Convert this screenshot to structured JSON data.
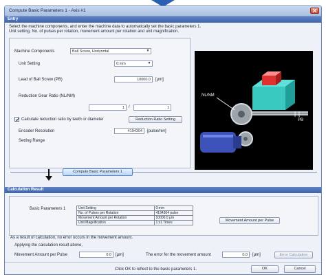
{
  "window": {
    "title": "Compute Basic Parameters 1 - Axis #1"
  },
  "entry": {
    "header": "Entry",
    "description_1": "Select the machine components, and enter the machine data to automatically set the basic parameters 1.",
    "description_2": "Unit setting, No. of pulses per rotation, movement amount per rotation and unit magnification.",
    "machine_components_label": "Machine Components",
    "machine_components_value": "Ball Screw, Horizontal",
    "unit_setting_label": "Unit Setting",
    "unit_setting_value": "0:mm",
    "lead_label": "Lead of Ball Screw (PB)",
    "lead_value": "10000.0",
    "lead_unit": "[μm]",
    "reduction_label": "Reduction Gear Ratio (NL/NM)",
    "reduction_num": "1",
    "reduction_den": "1",
    "reduction_sep": "/",
    "calc_checkbox_label": "Calculate reduction ratio by teeth or diameter",
    "reduction_ratio_setting_button": "Reduction Ratio Setting",
    "encoder_label": "Encoder Resolution",
    "encoder_value": "4194304",
    "encoder_unit": "[pulse/rev]",
    "setting_range_label": "Setting Range",
    "compute_button": "Compute Basic Parameters 1"
  },
  "diagram": {
    "nl_nm_label": "NL/NM",
    "pb_label": "PB"
  },
  "calc_result": {
    "header": "Calculation Result",
    "basic_params_label": "Basic Parameters 1",
    "rows": [
      {
        "name": "Unit Setting",
        "value": "0:mm"
      },
      {
        "name": "No. of Pulses per Rotation",
        "value": "4194304 pulse"
      },
      {
        "name": "Movement Amount per Rotation",
        "value": "10000.0 μm"
      },
      {
        "name": "Unit Magnification",
        "value": "1:x1 Times"
      }
    ],
    "movement_rule_button": "Movement Amount per Pulse",
    "note": "As a result of calculation, no error occurs in the movement amount.",
    "applying_label": "Applying the calculation result above,",
    "movement_amount_label": "Movement Amount per Pulse",
    "movement_amount_value": "0.0",
    "movement_amount_unit": "[μm]",
    "error_label": "The error for the movement amount",
    "error_value": "0.0",
    "error_unit": "[μm]",
    "error_calc_button": "Error Calculation"
  },
  "footer": {
    "hint": "Click OK to reflect to the basic parameters 1.",
    "ok": "OK",
    "cancel": "Cancel"
  },
  "colors": {
    "accent": "#3e63a8",
    "arrow": "#2b5fb5"
  }
}
